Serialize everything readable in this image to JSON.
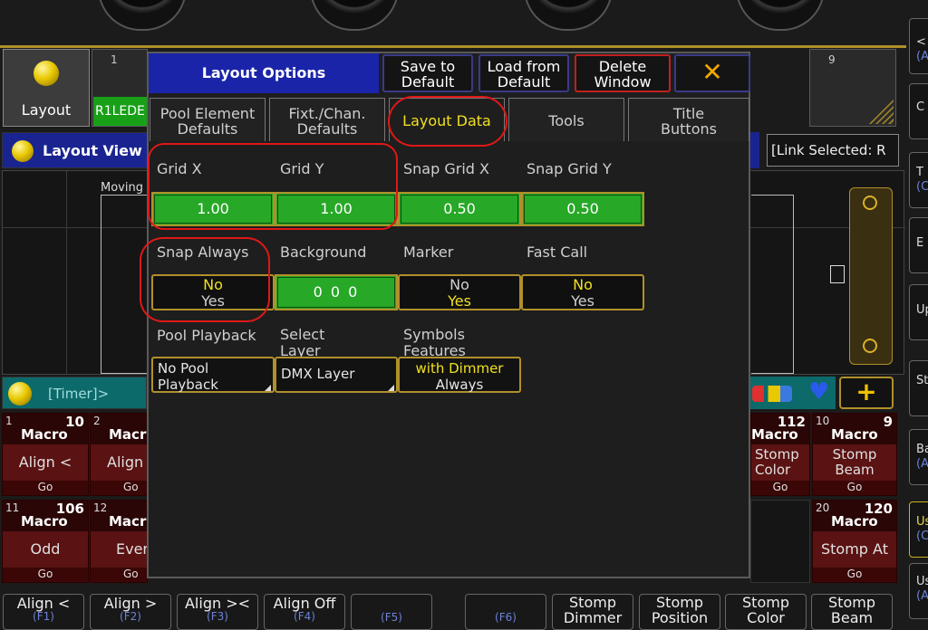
{
  "background": {
    "layout_button": {
      "label": "Layout"
    },
    "pool_cells": {
      "cell1_num": "1",
      "cell1_name": "R1LEDE",
      "cell9_num": "9"
    },
    "layout_view": {
      "title": "Layout View -",
      "moving_label": "Moving",
      "link_selected": "[Link Selected: R"
    },
    "timer_bar": {
      "label": "[Timer]>"
    },
    "macros": [
      {
        "num": "1",
        "tag": "Macro",
        "count": "10",
        "label": "Align <",
        "go": "Go"
      },
      {
        "num": "2",
        "tag": "Macr",
        "count": "",
        "label": "Align",
        "go": "Go"
      },
      {
        "num": "",
        "tag": "Macro",
        "count": "112",
        "label": "Stomp Color",
        "go": "Go"
      },
      {
        "num": "10",
        "tag": "Macro",
        "count": "9",
        "label": "Stomp Beam",
        "go": "Go"
      },
      {
        "num": "11",
        "tag": "Macro",
        "count": "106",
        "label": "Odd",
        "go": "Go"
      },
      {
        "num": "12",
        "tag": "Macr",
        "count": "",
        "label": "Ever",
        "go": "Go"
      },
      {
        "num": "20",
        "tag": "Macro",
        "count": "120",
        "label": "Stomp At",
        "go": "Go"
      }
    ],
    "fkeys": [
      {
        "label": "Align <",
        "sub": "(F1)"
      },
      {
        "label": "Align >",
        "sub": "(F2)"
      },
      {
        "label": "Align ><",
        "sub": "(F3)"
      },
      {
        "label": "Align Off",
        "sub": "(F4)"
      },
      {
        "label": "",
        "sub": "(F5)"
      },
      {
        "label": "",
        "sub": "(F6)"
      },
      {
        "label": "Stomp Dimmer",
        "sub": ""
      },
      {
        "label": "Stomp Position",
        "sub": ""
      },
      {
        "label": "Stomp Color",
        "sub": ""
      },
      {
        "label": "Stomp Beam",
        "sub": ""
      }
    ],
    "side_buttons": [
      {
        "line1": "<",
        "line2": "(A"
      },
      {
        "line1": "C",
        "line2": ""
      },
      {
        "line1": "T",
        "line2": "(C"
      },
      {
        "line1": "E",
        "line2": ""
      },
      {
        "line1": "Up",
        "line2": ""
      },
      {
        "line1": "St",
        "line2": ""
      },
      {
        "line1": "Ba",
        "line2": "(A"
      },
      {
        "line1": "Us",
        "line2": "(C"
      },
      {
        "line1": "Us",
        "line2": "(A"
      }
    ]
  },
  "dialog": {
    "title": "Layout Options",
    "buttons": {
      "save_line1": "Save to",
      "save_line2": "Default",
      "load_line1": "Load from",
      "load_line2": "Default",
      "delete_line1": "Delete",
      "delete_line2": "Window",
      "close": "✕"
    },
    "tabs": [
      {
        "line1": "Pool Element",
        "line2": "Defaults"
      },
      {
        "line1": "Fixt./Chan.",
        "line2": "Defaults"
      },
      {
        "line1": "Layout Data",
        "line2": ""
      },
      {
        "line1": "Tools",
        "line2": ""
      },
      {
        "line1": "Title",
        "line2": "Buttons"
      }
    ],
    "fields": {
      "grid_x": {
        "label": "Grid X",
        "value": "1.00"
      },
      "grid_y": {
        "label": "Grid Y",
        "value": "1.00"
      },
      "snap_grid_x": {
        "label": "Snap Grid X",
        "value": "0.50"
      },
      "snap_grid_y": {
        "label": "Snap Grid Y",
        "value": "0.50"
      },
      "snap_always": {
        "label": "Snap Always",
        "opt1": "No",
        "opt2": "Yes"
      },
      "background": {
        "label": "Background",
        "value": "0 0 0"
      },
      "marker": {
        "label": "Marker",
        "opt1": "No",
        "opt2": "Yes"
      },
      "fast_call": {
        "label": "Fast Call",
        "opt1": "No",
        "opt2": "Yes"
      },
      "pool_playback": {
        "label": "Pool Playback",
        "value_line1": "No Pool",
        "value_line2": "Playback"
      },
      "select_layer": {
        "label_line1": "Select",
        "label_line2": "Layer",
        "value": "DMX Layer"
      },
      "symbols_features": {
        "label_line1": "Symbols",
        "label_line2": "Features",
        "value_line1": "with Dimmer",
        "value_line2": "Always"
      }
    }
  },
  "colors": {
    "accent_gold": "#b0902a",
    "value_green": "#27a827",
    "highlight_yellow": "#f0e020",
    "annotation_red": "#e01818",
    "title_blue": "#1a24a8"
  }
}
